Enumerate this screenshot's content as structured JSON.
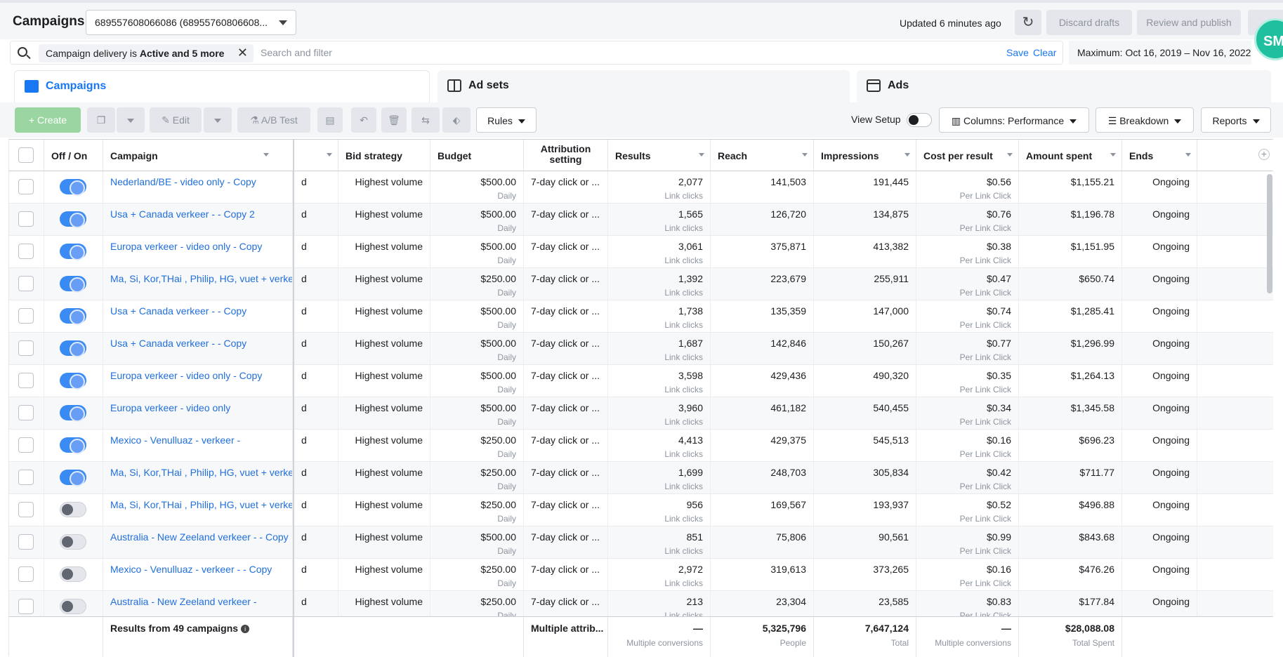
{
  "header": {
    "title": "Campaigns",
    "account": "689557608066086 (68955760806608...",
    "updated": "Updated 6 minutes ago",
    "refresh_icon": "↻",
    "discard": "Discard drafts",
    "review": "Review and publish",
    "badge": "SMi"
  },
  "filter": {
    "chip_prefix": "Campaign delivery is ",
    "chip_value": "Active and 5 more",
    "chip_close": "✕",
    "placeholder": "Search and filter",
    "save": "Save",
    "clear": "Clear",
    "date_range": "Maximum: Oct 16, 2019 – Nov 16, 2022"
  },
  "tabs": [
    {
      "label": "Campaigns"
    },
    {
      "label": "Ad sets"
    },
    {
      "label": "Ads"
    }
  ],
  "toolbar": {
    "create": "+  Create",
    "edit": "Edit",
    "ab_test": "A/B Test",
    "rules": "Rules",
    "view_setup": "View Setup",
    "columns": "Columns: Performance",
    "breakdown": "Breakdown",
    "reports": "Reports"
  },
  "columns": {
    "offon": "Off / On",
    "campaign": "Campaign",
    "bid": "Bid strategy",
    "budget": "Budget",
    "attr1": "Attribution",
    "attr2": "setting",
    "results": "Results",
    "reach": "Reach",
    "impressions": "Impressions",
    "cpr": "Cost per result",
    "spent": "Amount spent",
    "ends": "Ends"
  },
  "rows": [
    {
      "on": true,
      "name": "Nederland/BE - video only - Copy",
      "hidden": "d",
      "bid": "Highest volume",
      "budget": "$500.00",
      "budget_type": "Daily",
      "attr": "7-day click or ...",
      "results": "2,077",
      "results_type": "Link clicks",
      "reach": "141,503",
      "impressions": "191,445",
      "cpr": "$0.56",
      "cpr_type": "Per Link Click",
      "spent": "$1,155.21",
      "ends": "Ongoing"
    },
    {
      "on": true,
      "name": "Usa + Canada verkeer - - Copy 2",
      "hidden": "d",
      "bid": "Highest volume",
      "budget": "$500.00",
      "budget_type": "Daily",
      "attr": "7-day click or ...",
      "results": "1,565",
      "results_type": "Link clicks",
      "reach": "126,720",
      "impressions": "134,875",
      "cpr": "$0.76",
      "cpr_type": "Per Link Click",
      "spent": "$1,196.78",
      "ends": "Ongoing"
    },
    {
      "on": true,
      "name": "Europa verkeer - video only - Copy",
      "hidden": "d",
      "bid": "Highest volume",
      "budget": "$500.00",
      "budget_type": "Daily",
      "attr": "7-day click or ...",
      "results": "3,061",
      "results_type": "Link clicks",
      "reach": "375,871",
      "impressions": "413,382",
      "cpr": "$0.38",
      "cpr_type": "Per Link Click",
      "spent": "$1,151.95",
      "ends": "Ongoing"
    },
    {
      "on": true,
      "name": "Ma, Si, Kor,THai , Philip, HG, vuet + verkeer - - ...",
      "hidden": "d",
      "bid": "Highest volume",
      "budget": "$250.00",
      "budget_type": "Daily",
      "attr": "7-day click or ...",
      "results": "1,392",
      "results_type": "Link clicks",
      "reach": "223,679",
      "impressions": "255,911",
      "cpr": "$0.47",
      "cpr_type": "Per Link Click",
      "spent": "$650.74",
      "ends": "Ongoing"
    },
    {
      "on": true,
      "name": "Usa + Canada verkeer - - Copy",
      "hidden": "d",
      "bid": "Highest volume",
      "budget": "$500.00",
      "budget_type": "Daily",
      "attr": "7-day click or ...",
      "results": "1,738",
      "results_type": "Link clicks",
      "reach": "135,359",
      "impressions": "147,000",
      "cpr": "$0.74",
      "cpr_type": "Per Link Click",
      "spent": "$1,285.41",
      "ends": "Ongoing"
    },
    {
      "on": true,
      "name": "Usa + Canada verkeer - - Copy",
      "hidden": "d",
      "bid": "Highest volume",
      "budget": "$500.00",
      "budget_type": "Daily",
      "attr": "7-day click or ...",
      "results": "1,687",
      "results_type": "Link clicks",
      "reach": "142,846",
      "impressions": "150,267",
      "cpr": "$0.77",
      "cpr_type": "Per Link Click",
      "spent": "$1,296.99",
      "ends": "Ongoing"
    },
    {
      "on": true,
      "name": "Europa verkeer - video only - Copy",
      "hidden": "d",
      "bid": "Highest volume",
      "budget": "$500.00",
      "budget_type": "Daily",
      "attr": "7-day click or ...",
      "results": "3,598",
      "results_type": "Link clicks",
      "reach": "429,436",
      "impressions": "490,320",
      "cpr": "$0.35",
      "cpr_type": "Per Link Click",
      "spent": "$1,264.13",
      "ends": "Ongoing"
    },
    {
      "on": true,
      "name": "Europa verkeer - video only",
      "hidden": "d",
      "bid": "Highest volume",
      "budget": "$500.00",
      "budget_type": "Daily",
      "attr": "7-day click or ...",
      "results": "3,960",
      "results_type": "Link clicks",
      "reach": "461,182",
      "impressions": "540,455",
      "cpr": "$0.34",
      "cpr_type": "Per Link Click",
      "spent": "$1,345.58",
      "ends": "Ongoing"
    },
    {
      "on": true,
      "name": "Mexico - Venulluaz - verkeer -",
      "hidden": "d",
      "bid": "Highest volume",
      "budget": "$250.00",
      "budget_type": "Daily",
      "attr": "7-day click or ...",
      "results": "4,413",
      "results_type": "Link clicks",
      "reach": "429,375",
      "impressions": "545,513",
      "cpr": "$0.16",
      "cpr_type": "Per Link Click",
      "spent": "$696.23",
      "ends": "Ongoing"
    },
    {
      "on": true,
      "name": "Ma, Si, Kor,THai , Philip, HG, vuet + verkeer - - ...",
      "hidden": "d",
      "bid": "Highest volume",
      "budget": "$250.00",
      "budget_type": "Daily",
      "attr": "7-day click or ...",
      "results": "1,699",
      "results_type": "Link clicks",
      "reach": "248,703",
      "impressions": "305,834",
      "cpr": "$0.42",
      "cpr_type": "Per Link Click",
      "spent": "$711.77",
      "ends": "Ongoing"
    },
    {
      "on": false,
      "name": "Ma, Si, Kor,THai , Philip, HG, vuet + verkeer - - ...",
      "hidden": "d",
      "bid": "Highest volume",
      "budget": "$250.00",
      "budget_type": "Daily",
      "attr": "7-day click or ...",
      "results": "956",
      "results_type": "Link clicks",
      "reach": "169,567",
      "impressions": "193,937",
      "cpr": "$0.52",
      "cpr_type": "Per Link Click",
      "spent": "$496.88",
      "ends": "Ongoing"
    },
    {
      "on": false,
      "name": "Australia - New Zeeland verkeer - - Copy",
      "hidden": "d",
      "bid": "Highest volume",
      "budget": "$500.00",
      "budget_type": "Daily",
      "attr": "7-day click or ...",
      "results": "851",
      "results_type": "Link clicks",
      "reach": "75,806",
      "impressions": "90,561",
      "cpr": "$0.99",
      "cpr_type": "Per Link Click",
      "spent": "$843.68",
      "ends": "Ongoing"
    },
    {
      "on": false,
      "name": "Mexico - Venulluaz - verkeer - - Copy",
      "hidden": "d",
      "bid": "Highest volume",
      "budget": "$250.00",
      "budget_type": "Daily",
      "attr": "7-day click or ...",
      "results": "2,972",
      "results_type": "Link clicks",
      "reach": "319,613",
      "impressions": "373,265",
      "cpr": "$0.16",
      "cpr_type": "Per Link Click",
      "spent": "$476.26",
      "ends": "Ongoing"
    },
    {
      "on": false,
      "name": "Australia - New Zeeland verkeer -",
      "hidden": "d",
      "bid": "Highest volume",
      "budget": "$250.00",
      "budget_type": "Daily",
      "attr": "7-day click or ...",
      "results": "213",
      "results_type": "Link clicks",
      "reach": "23,304",
      "impressions": "23,585",
      "cpr": "$0.83",
      "cpr_type": "Per Link Click",
      "spent": "$177.84",
      "ends": "Ongoing"
    }
  ],
  "footer": {
    "label": "Results from 49 campaigns",
    "info_icon": "i",
    "attr": "Multiple attrib...",
    "results": "—",
    "results_sub": "Multiple conversions",
    "reach": "5,325,796",
    "reach_sub": "People",
    "impressions": "7,647,124",
    "impressions_sub": "Total",
    "cpr": "—",
    "cpr_sub": "Multiple conversions",
    "spent": "$28,088.08",
    "spent_sub": "Total Spent"
  }
}
